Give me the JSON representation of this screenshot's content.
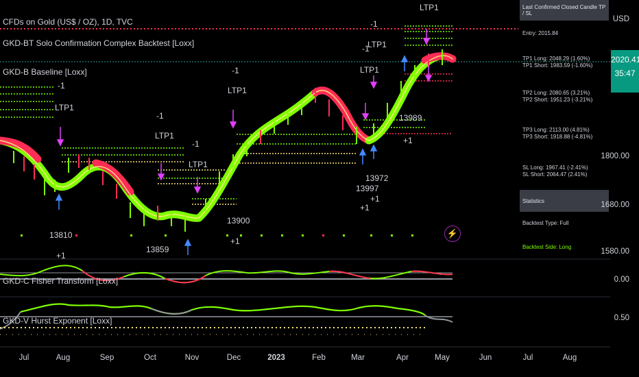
{
  "legend": {
    "symbol": "CFDs on Gold (US$ / OZ), 1D, TVC",
    "indicator1": "GKD-BT Solo Confirmation Complex Backtest [Loxx]",
    "indicator2": "GKD-B Baseline [Loxx]",
    "indicator3": "GKD-C Fisher Transform [Loxx]",
    "indicator4": "GKD-V Hurst Exponent [Loxx]"
  },
  "price_axis": {
    "currency": "USD",
    "labels": [
      "1800.00",
      "1680.00",
      "1580.00"
    ],
    "osc1_label": "0.00",
    "osc2_label": "0.50",
    "last_price": "2020.41",
    "countdown": "35:47"
  },
  "time_axis": [
    "Jul",
    "Aug",
    "Sep",
    "Oct",
    "Nov",
    "Dec",
    "2023",
    "Feb",
    "Mar",
    "Apr",
    "May",
    "Jun",
    "Jul",
    "Aug"
  ],
  "side_panel": {
    "title": "Last Confirmed Closed Candle TP / SL",
    "entry": "Entry: 2015.84",
    "tp1_long": "TP1 Long: 2048.29 (1.60%)",
    "tp1_short": "TP1 Short: 1983.59 (-1.60%)",
    "tp2_long": "TP2 Long: 2080.65 (3.21%)",
    "tp2_short": "TP2 Short: 1951.23 (-3.21%)",
    "tp3_long": "TP3 Long: 2113.00 (4.81%)",
    "tp3_short": "TP3 Short: 1918.88 (-4.81%)",
    "sl_long": "SL Long: 1967.41 (-2.41%)",
    "sl_short": "SL Short: 2064.47 (2.41%)",
    "stats_title": "Statistics",
    "backtest_type": "Backtest Type: Full",
    "backtest_side": "Backtest Side: Long"
  },
  "annotations": {
    "ltp1": "LTP1",
    "minus1": "-1",
    "plus1": "+1",
    "trade_ids": [
      "13810",
      "13859",
      "13900",
      "13989",
      "13972",
      "13997"
    ]
  },
  "colors": {
    "background": "#000000",
    "bull": "#7fff00",
    "bear": "#ff2d55",
    "baseline_yellow": "#ffe57f",
    "badge": "#089981",
    "magenta": "#e040fb",
    "arrow_blue": "#448aff",
    "grey": "#9598a1"
  },
  "icons": {
    "lightning": "⚡"
  }
}
